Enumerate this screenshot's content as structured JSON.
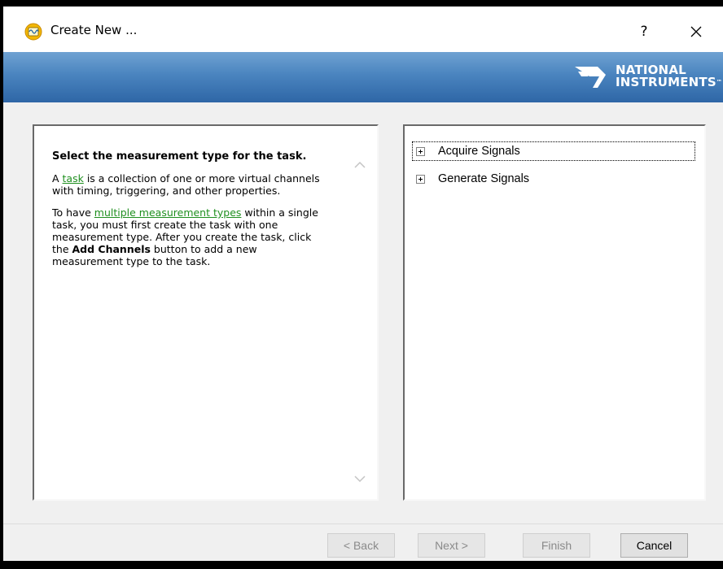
{
  "window": {
    "title": "Create New ...",
    "help_label": "?"
  },
  "banner": {
    "logo_line1": "NATIONAL",
    "logo_line2": "INSTRUMENTS",
    "logo_tm": "™"
  },
  "help": {
    "heading": "Select the measurement type for the task.",
    "p1_pre": "A ",
    "p1_link": "task",
    "p1_post": " is a collection of one or more virtual channels with timing, triggering, and other properties.",
    "p2_pre": "To have ",
    "p2_link": "multiple measurement types",
    "p2_mid": " within a single task, you must first create the task with one measurement type. After you create the task, click the ",
    "p2_bold": "Add Channels",
    "p2_post": " button to add a new measurement type to the task."
  },
  "tree": {
    "items": [
      {
        "label": "Acquire Signals"
      },
      {
        "label": "Generate Signals"
      }
    ]
  },
  "buttons": {
    "back": "< Back",
    "next": "Next >",
    "finish": "Finish",
    "cancel": "Cancel"
  }
}
